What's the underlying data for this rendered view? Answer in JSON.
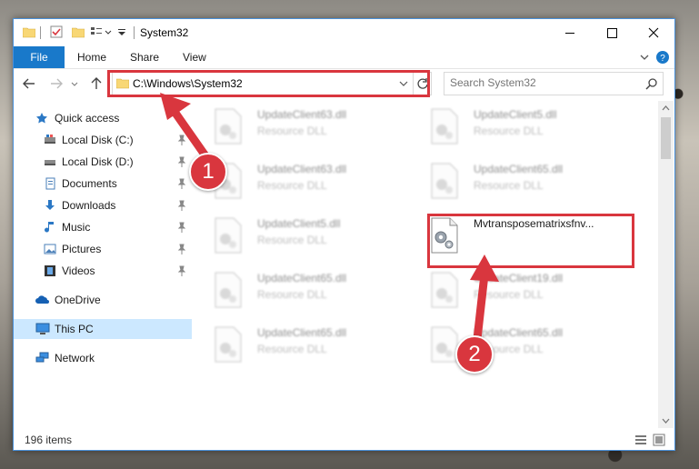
{
  "window": {
    "title": "System32",
    "controls": [
      "minimize-icon",
      "maximize-icon",
      "close-icon"
    ]
  },
  "ribbon": {
    "tabs": [
      {
        "label": "File",
        "active": true
      },
      {
        "label": "Home"
      },
      {
        "label": "Share"
      },
      {
        "label": "View"
      }
    ],
    "accent": "#1979ca"
  },
  "navigation": {
    "address": "C:\\Windows\\System32",
    "search_placeholder": "Search System32"
  },
  "sidebar": {
    "items": [
      {
        "label": "Quick access",
        "icon": "star-icon",
        "pinned": false
      },
      {
        "label": "Local Disk (C:)",
        "icon": "drive-icon",
        "pinned": true
      },
      {
        "label": "Local Disk (D:)",
        "icon": "drive-icon",
        "pinned": true
      },
      {
        "label": "Documents",
        "icon": "documents-icon",
        "pinned": true
      },
      {
        "label": "Downloads",
        "icon": "downloads-icon",
        "pinned": true
      },
      {
        "label": "Music",
        "icon": "music-icon",
        "pinned": true
      },
      {
        "label": "Pictures",
        "icon": "pictures-icon",
        "pinned": true
      },
      {
        "label": "Videos",
        "icon": "videos-icon",
        "pinned": true
      },
      {
        "label": "OneDrive",
        "icon": "cloud-icon",
        "pinned": false
      },
      {
        "label": "This PC",
        "icon": "computer-icon",
        "pinned": false,
        "selected": true
      },
      {
        "label": "Network",
        "icon": "network-icon",
        "pinned": false
      }
    ]
  },
  "files": [
    {
      "name": "UpdateClient63.dll",
      "type": "Resource DLL",
      "blurred": true
    },
    {
      "name": "UpdateClient5.dll",
      "type": "Resource DLL",
      "blurred": true
    },
    {
      "name": "UpdateClient63.dll",
      "type": "Resource DLL",
      "blurred": true
    },
    {
      "name": "UpdateClient65.dll",
      "type": "Resource DLL",
      "blurred": true
    },
    {
      "name": "UpdateClient5.dll",
      "type": "Resource DLL",
      "blurred": true
    },
    {
      "name": "Mvtransposematrixsfnv...",
      "type": "",
      "blurred": false,
      "highlighted": true
    },
    {
      "name": "UpdateClient65.dll",
      "type": "Resource DLL",
      "blurred": true
    },
    {
      "name": "UpdateClient19.dll",
      "type": "Resource DLL",
      "blurred": true
    },
    {
      "name": "UpdateClient65.dll",
      "type": "Resource DLL",
      "blurred": true
    },
    {
      "name": "UpdateClient65.dll",
      "type": "Resource DLL",
      "blurred": true
    }
  ],
  "status": {
    "item_count": "196 items"
  },
  "callouts": [
    {
      "number": "1"
    },
    {
      "number": "2"
    }
  ],
  "colors": {
    "highlight": "#d9363e",
    "selection": "#cce8ff"
  }
}
